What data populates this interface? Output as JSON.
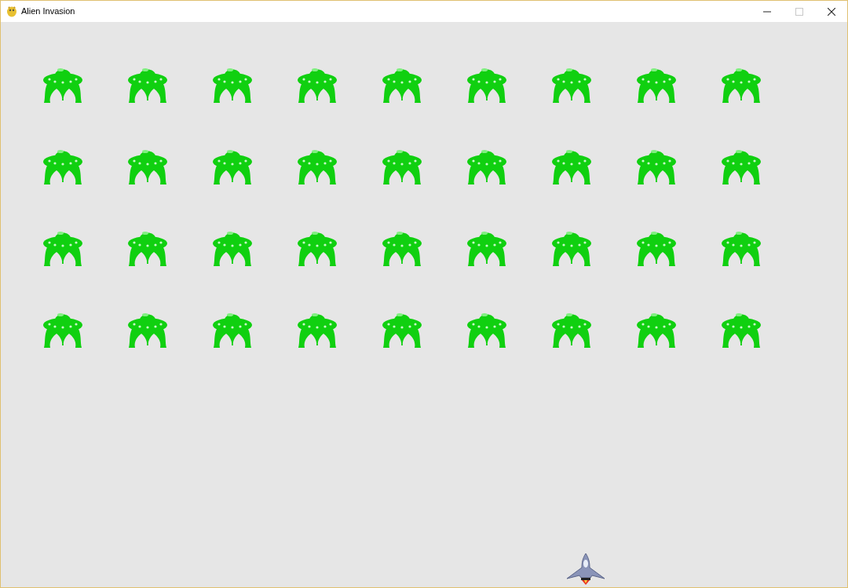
{
  "window": {
    "title": "Alien Invasion",
    "controls": [
      {
        "kind": "minimize",
        "disabled": false
      },
      {
        "kind": "maximize",
        "disabled": true
      },
      {
        "kind": "close",
        "disabled": false
      }
    ]
  }
}
